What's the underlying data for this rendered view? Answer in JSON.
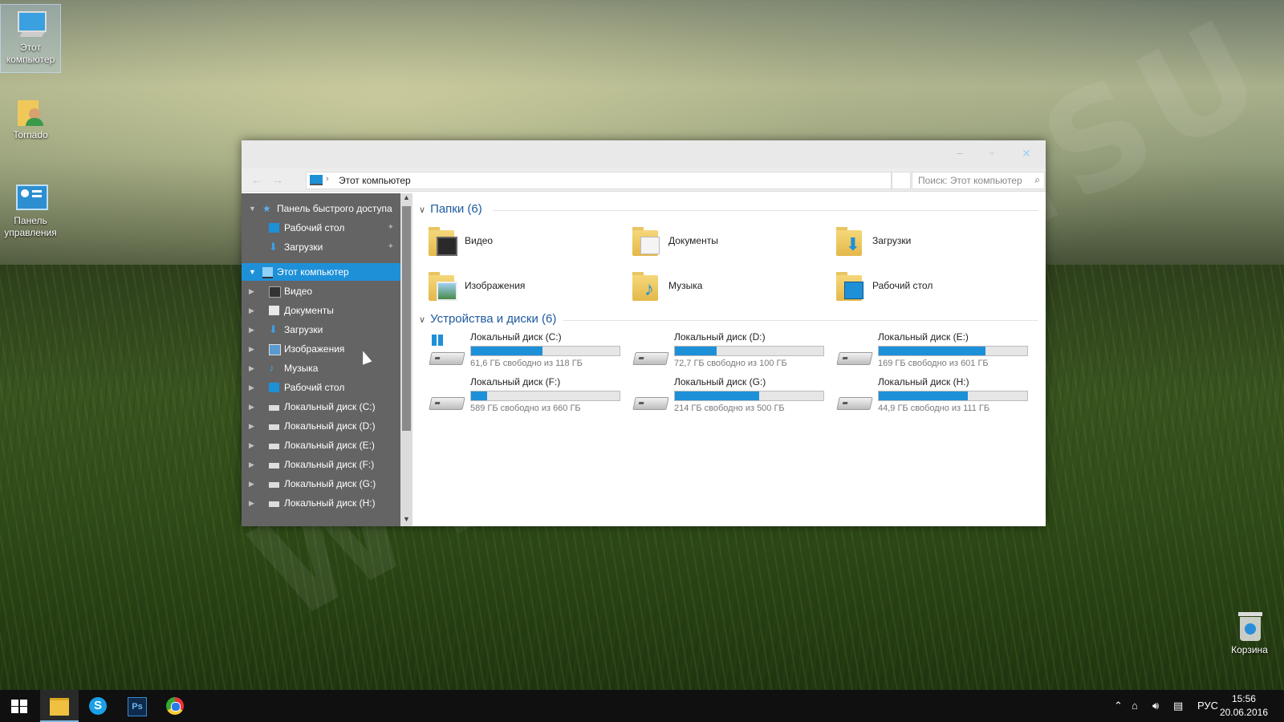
{
  "desktop": {
    "icons": [
      {
        "label": "Этот компьютер",
        "icon": "computer-icon"
      },
      {
        "label": "Tornado",
        "icon": "user-folder-icon"
      },
      {
        "label": "Панель управления",
        "icon": "control-panel-icon"
      },
      {
        "label": "Корзина",
        "icon": "recycle-bin-icon"
      }
    ],
    "watermark": "WTHEMES.SU"
  },
  "window": {
    "address": "Этот компьютер",
    "search_placeholder": "Поиск: Этот компьютер",
    "controls": {
      "minimize": "–",
      "maximize": "▫",
      "close": "✕"
    }
  },
  "nav": {
    "quick_access": "Панель быстрого доступа",
    "quick_items": [
      "Рабочий стол",
      "Загрузки"
    ],
    "this_pc": "Этот компьютер",
    "pc_items": [
      "Видео",
      "Документы",
      "Загрузки",
      "Изображения",
      "Музыка",
      "Рабочий стол",
      "Локальный диск (C:)",
      "Локальный диск (D:)",
      "Локальный диск (E:)",
      "Локальный диск (F:)",
      "Локальный диск (G:)",
      "Локальный диск (H:)"
    ]
  },
  "content": {
    "folders_header": "Папки (6)",
    "folders": [
      "Видео",
      "Документы",
      "Загрузки",
      "Изображения",
      "Музыка",
      "Рабочий стол"
    ],
    "drives_header": "Устройства и диски (6)",
    "drives": [
      {
        "name": "Локальный диск (C:)",
        "free": "61,6 ГБ свободно из 118 ГБ",
        "used_fraction": 0.48
      },
      {
        "name": "Локальный диск (D:)",
        "free": "72,7 ГБ свободно из 100 ГБ",
        "used_fraction": 0.28
      },
      {
        "name": "Локальный диск (E:)",
        "free": "169 ГБ свободно из 601 ГБ",
        "used_fraction": 0.72
      },
      {
        "name": "Локальный диск (F:)",
        "free": "589 ГБ свободно из 660 ГБ",
        "used_fraction": 0.11
      },
      {
        "name": "Локальный диск (G:)",
        "free": "214 ГБ свободно из 500 ГБ",
        "used_fraction": 0.57
      },
      {
        "name": "Локальный диск (H:)",
        "free": "44,9 ГБ свободно из 111 ГБ",
        "used_fraction": 0.6
      }
    ]
  },
  "taskbar": {
    "lang": "РУС",
    "time": "15:56",
    "date": "20.06.2016"
  },
  "colors": {
    "accent": "#1e90d8",
    "nav_bg": "#646464"
  }
}
